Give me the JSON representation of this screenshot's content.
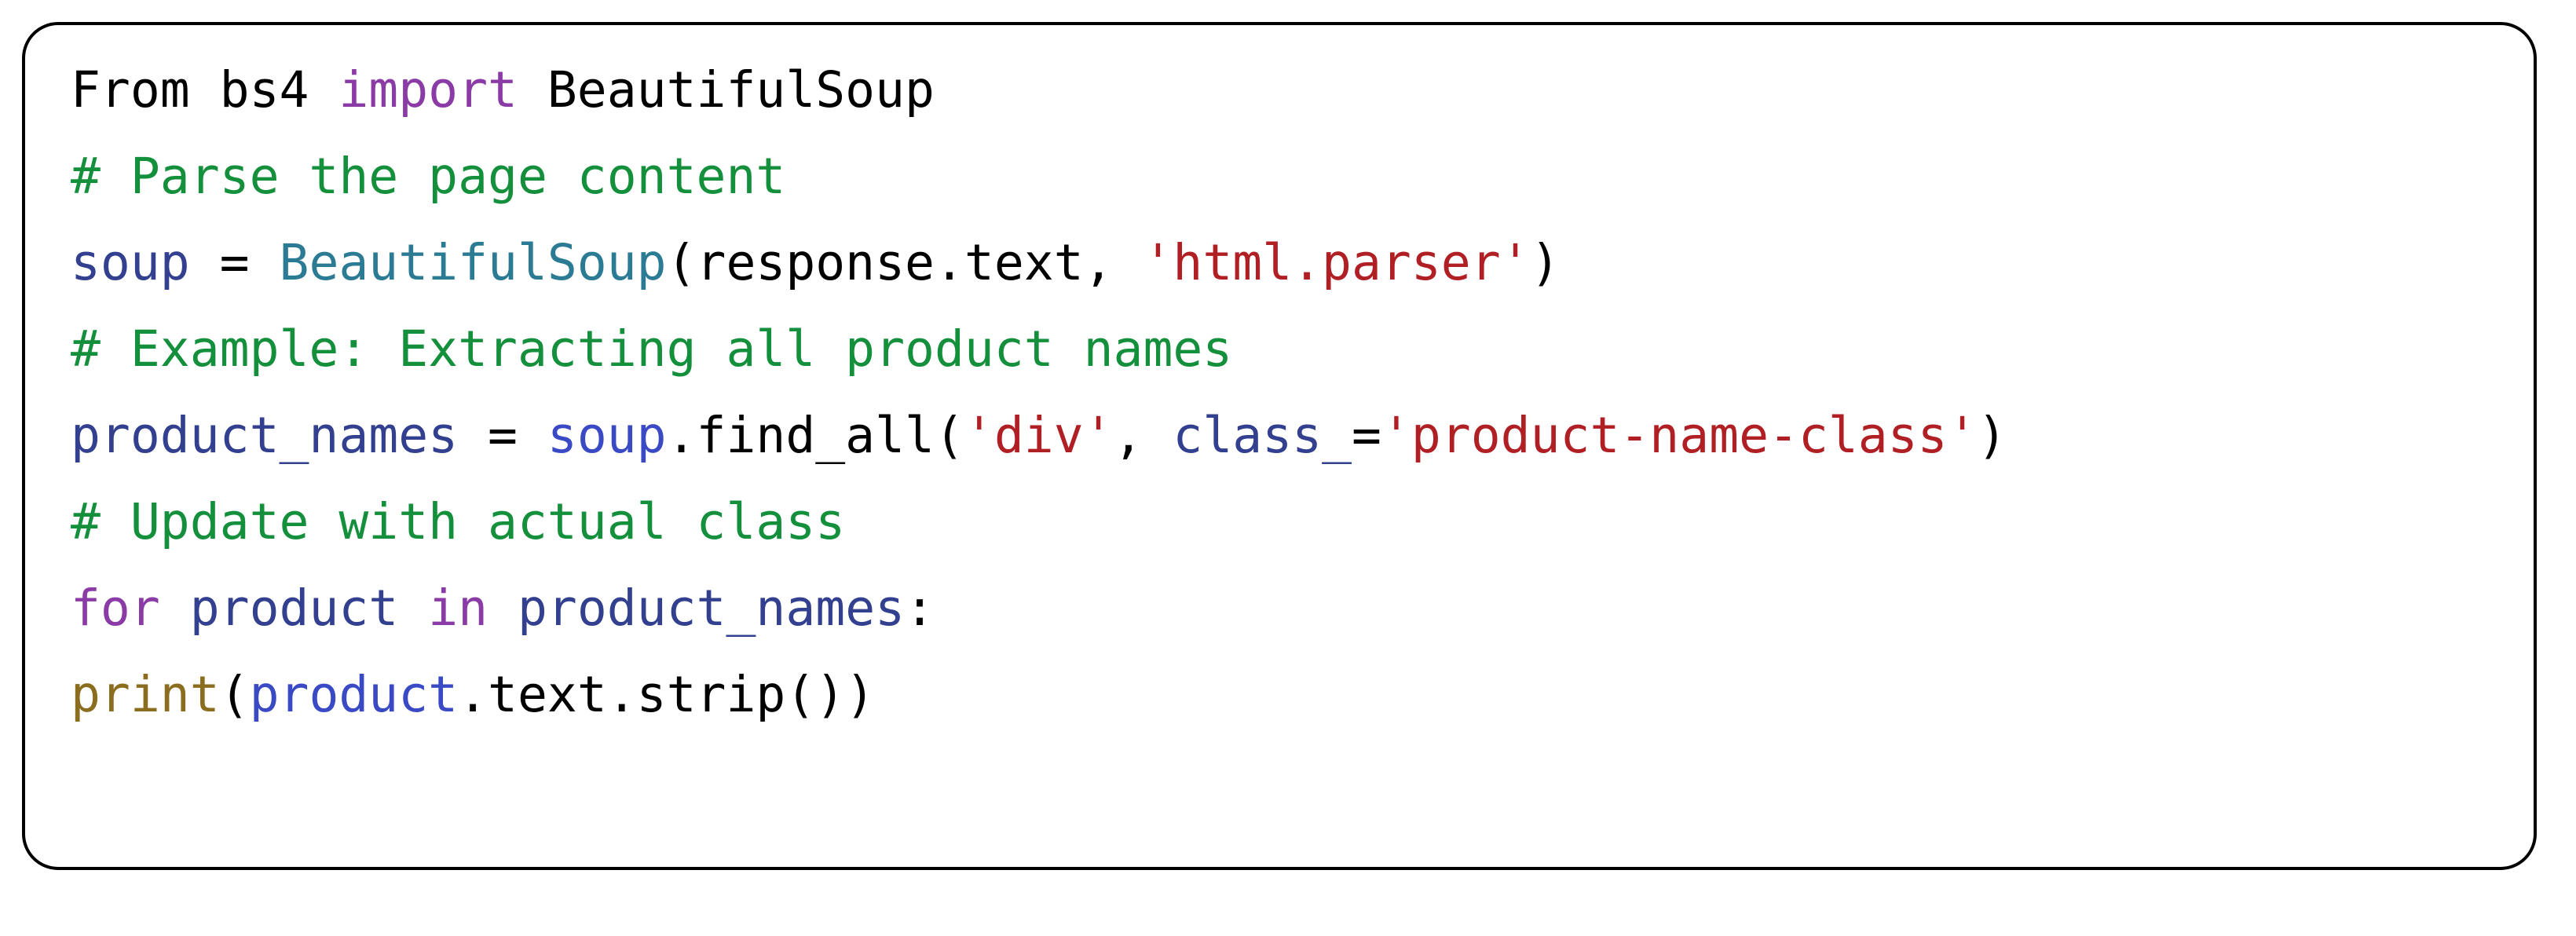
{
  "card": {
    "background": "#ffffff",
    "border_color": "#000000",
    "border_radius_px": 46,
    "border_width_px": 4
  },
  "syntax_colors": {
    "plain": "#000000",
    "keyword": "#8b3ba6",
    "comment": "#148f3c",
    "string": "#b01f24",
    "class_name": "#2b7b95",
    "variable": "#32408f",
    "attribute": "#3a49c4",
    "builtin": "#8a6d1f"
  },
  "code": {
    "language": "python",
    "plain_text": "From bs4 import BeautifulSoup\n# Parse the page content\nsoup = BeautifulSoup(response.text, 'html.parser')\n# Example: Extracting all product names\nproduct_names = soup.find_all('div', class_='product-name-class')\n# Update with actual class\nfor product in product_names:\nprint(product.text.strip())",
    "lines": [
      {
        "id": "line-1",
        "tokens": [
          {
            "t": "From bs4 ",
            "c": "plain"
          },
          {
            "t": "import",
            "c": "keyword"
          },
          {
            "t": " BeautifulSoup",
            "c": "plain"
          }
        ]
      },
      {
        "id": "line-2",
        "tokens": [
          {
            "t": "# Parse the page content",
            "c": "comment"
          }
        ]
      },
      {
        "id": "line-3",
        "tokens": [
          {
            "t": "soup",
            "c": "variable"
          },
          {
            "t": " = ",
            "c": "plain"
          },
          {
            "t": "BeautifulSoup",
            "c": "class_name"
          },
          {
            "t": "(response.text, ",
            "c": "plain"
          },
          {
            "t": "'html.parser'",
            "c": "string"
          },
          {
            "t": ")",
            "c": "plain"
          }
        ]
      },
      {
        "id": "line-4",
        "tokens": [
          {
            "t": "# Example: Extracting all product names",
            "c": "comment"
          }
        ]
      },
      {
        "id": "line-5",
        "tokens": [
          {
            "t": "product_names",
            "c": "variable"
          },
          {
            "t": " = ",
            "c": "plain"
          },
          {
            "t": "soup",
            "c": "attribute"
          },
          {
            "t": ".find_all(",
            "c": "plain"
          },
          {
            "t": "'div'",
            "c": "string"
          },
          {
            "t": ", ",
            "c": "plain"
          },
          {
            "t": "class_",
            "c": "variable"
          },
          {
            "t": "=",
            "c": "plain"
          },
          {
            "t": "'product-name-class'",
            "c": "string"
          },
          {
            "t": ")",
            "c": "plain"
          }
        ]
      },
      {
        "id": "line-6",
        "tokens": [
          {
            "t": "# Update with actual class",
            "c": "comment"
          }
        ]
      },
      {
        "id": "line-7",
        "tokens": [
          {
            "t": "for",
            "c": "keyword"
          },
          {
            "t": " ",
            "c": "plain"
          },
          {
            "t": "product",
            "c": "variable"
          },
          {
            "t": " ",
            "c": "plain"
          },
          {
            "t": "in",
            "c": "keyword"
          },
          {
            "t": " ",
            "c": "plain"
          },
          {
            "t": "product_names",
            "c": "variable"
          },
          {
            "t": ":",
            "c": "plain"
          }
        ]
      },
      {
        "id": "line-8",
        "tokens": [
          {
            "t": "print",
            "c": "builtin"
          },
          {
            "t": "(",
            "c": "plain"
          },
          {
            "t": "product",
            "c": "attribute"
          },
          {
            "t": ".text.strip())",
            "c": "plain"
          }
        ]
      }
    ]
  }
}
